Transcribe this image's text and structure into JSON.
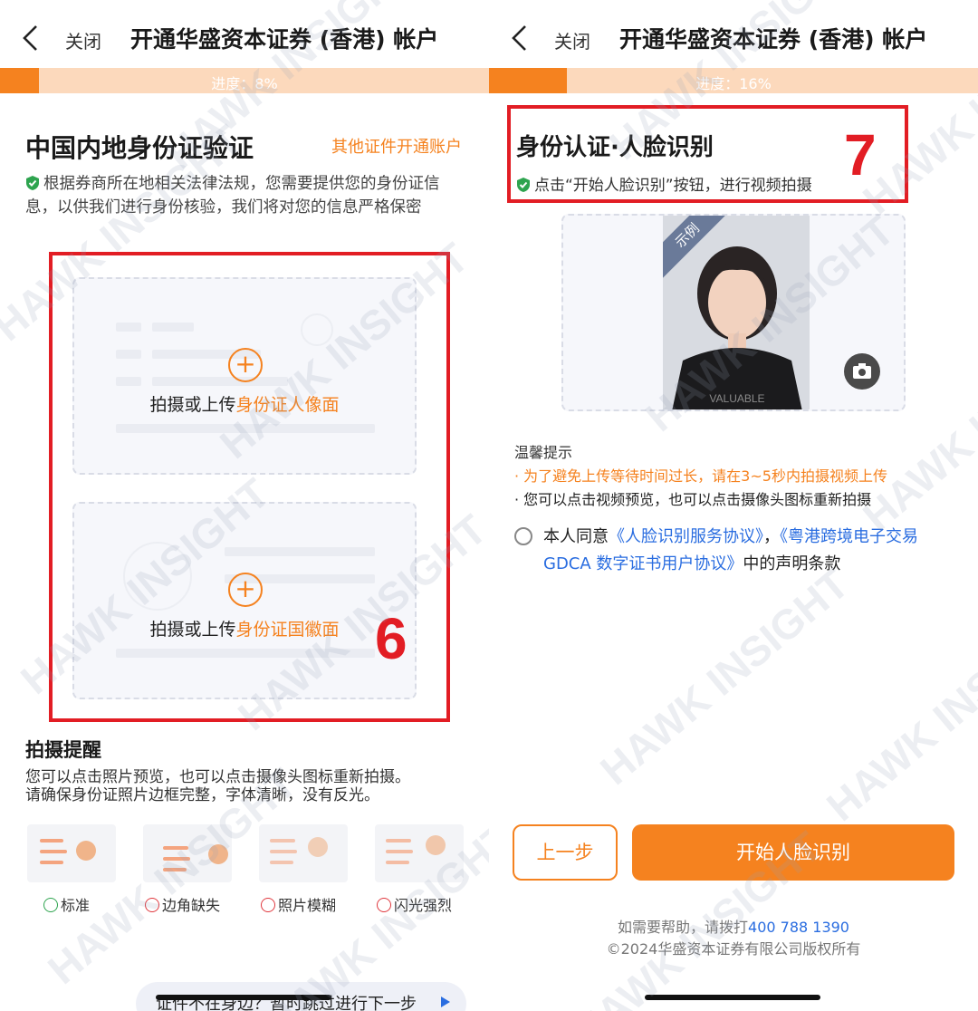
{
  "left": {
    "nav": {
      "close_label": "关闭",
      "title": "开通华盛资本证券 (香港) 帐户"
    },
    "progress": {
      "label": "进度：8%",
      "value_percent": 8
    },
    "heading": "中国内地身份证验证",
    "other_link": "其他证件开通账户",
    "description": "根据券商所在地相关法律法规，您需要提供您的身份证信息，以供我们进行身份核验，我们将对您的信息严格保密",
    "front_upload": {
      "prefix": "拍摄或上传",
      "highlight": "身份证人像面"
    },
    "back_upload": {
      "prefix": "拍摄或上传",
      "highlight": "身份证国徽面"
    },
    "annotation_number": "6",
    "tips_title": "拍摄提醒",
    "tips_line1": "您可以点击照片预览，也可以点击摄像头图标重新拍摄。",
    "tips_line2": "请确保身份证照片边框完整，字体清晰，没有反光。",
    "samples": [
      {
        "label": "标准",
        "status": "ok"
      },
      {
        "label": "边角缺失",
        "status": "bad"
      },
      {
        "label": "照片模糊",
        "status": "bad"
      },
      {
        "label": "闪光强烈",
        "status": "bad"
      }
    ],
    "skip_label": "证件不在身边？暂时跳过进行下一步"
  },
  "right": {
    "nav": {
      "close_label": "关闭",
      "title": "开通华盛资本证券 (香港) 帐户"
    },
    "progress": {
      "label": "进度：16%",
      "value_percent": 16
    },
    "heading": "身份认证·人脸识别",
    "subtitle": "点击“开始人脸识别”按钮，进行视频拍摄",
    "annotation_number": "7",
    "sample_badge": "示例",
    "shirt_text": "VALUABLE",
    "notice_title": "温馨提示",
    "notice_1": "· 为了避免上传等待时间过长，请在3~5秒内拍摄视频上传",
    "notice_2": "· 您可以点击视频预览，也可以点击摄像头图标重新拍摄",
    "agree_prefix": "本人同意",
    "agree_link1": "《人脸识别服务协议》",
    "agree_sep": "，",
    "agree_link2": "《粤港跨境电子交易GDCA 数字证书用户协议》",
    "agree_suffix": "中的声明条款",
    "prev_button": "上一步",
    "start_button": "开始人脸识别",
    "help_prefix": "如需要帮助，请拨打",
    "help_phone": "400 788 1390",
    "copyright": "©2024华盛资本证券有限公司版权所有"
  },
  "watermark": "HAWK INSIGHT",
  "colors": {
    "accent": "#f5821f",
    "annotation_red": "#e21d24",
    "link_blue": "#2a6de0"
  }
}
